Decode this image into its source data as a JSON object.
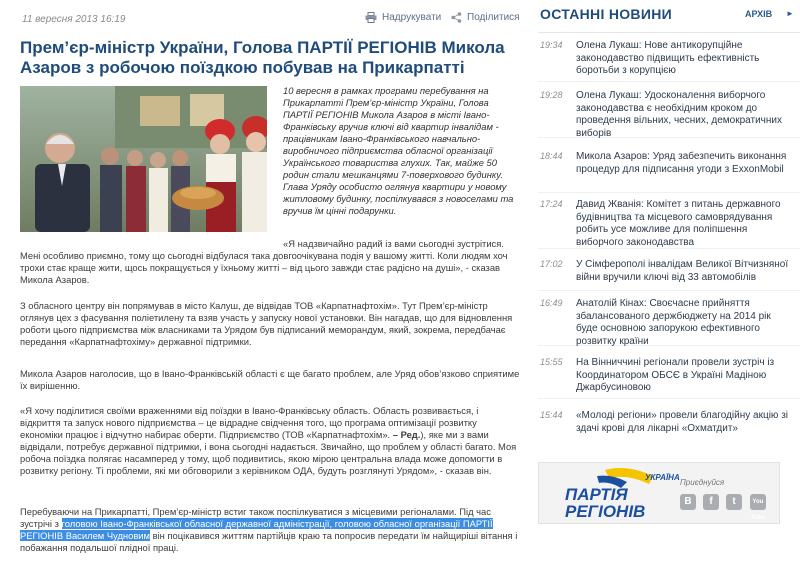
{
  "article": {
    "date": "11 вересня 2013 16:19",
    "print_label": "Надрукувати",
    "share_label": "Поділитися",
    "title": "Прем’єр-міністр України, Голова ПАРТІЇ РЕГІОНІВ Микола Азаров з робочою поїздкою побував на Прикарпатті",
    "lead": "10 вересня в рамках програми перебування на Прикарпатті Прем’єр-міністр України, Голова ПАРТІЇ РЕГІОНІВ Микола Азаров в місті Івано-Франківську вручив ключі від квартир інвалідам - працівникам Івано-Франківського навчально-виробничого підприємства обласної організації Українського товариства глухих. Так, майже 50 родин стали мешканцями 7-поверхового будинку. Глава Уряду особисто оглянув квартири у новому житловому будинку, поспілкувався з новоселами та вручив їм цінні подарунки.",
    "quote1_start": "«Я надзвичайно радий із вами сьогодні зустрітися.",
    "quote1_rest": "Мені особливо приємно, тому що сьогодні відбулася така довгоочікувана подія у вашому житті. Коли людям хоч трохи стає краще жити, щось покращується у їхньому житті – від цього завжди стає радісно на душі», - сказав Микола Азаров.",
    "p2": "З обласного центру він попрямував в місто Калуш, де відвідав ТОВ «Карпатнафтохім». Тут Прем’єр-міністр оглянув цех з фасування поліетилену та взяв участь у запуску нової установки. Він нагадав, що для відновлення роботи цього підприємства між власниками та Урядом був підписаний меморандум, який, зокрема, передбачає передання «Карпатнафтохіму» державної підтримки.",
    "p3": "Микола Азаров наголосив, що в Івано-Франківській області є ще багато проблем, але Уряд обов’язково сприятиме їх вирішенню.",
    "p4_a": "«Я хочу поділитися своїми враженнями від поїздки в Івано-Франківську область. Область розвивається, і відкриття та запуск нового підприємства – це відрадне свідчення того, що програма оптимізації розвитку економіки працює і відчутно набирає оберти. Підприємство (ТОВ «Карпатнафтохім».",
    "p4_red": "– Ред.",
    "p4_b": "), яке ми з вами відвідали, потребує державної підтримки, і вона сьогодні надається. Звичайно, що проблем у області багато. Моя робоча поїздка полягає насамперед у тому, щоб подивитись, якою мірою центральна влада може допомогти в розвитку регіону. Ті проблеми, які ми обговорили з керівником ОДА, будуть розглянуті Урядом», - сказав він.",
    "p5_a": "Перебуваючи на Прикарпатті, Прем’єр-міністр встиг також поспілкуватися з місцевими регіоналами. Під час зустрічі з",
    "p5_hl": "головою Івано-Франківської обласної державної адміністрації, головою обласної організації ПАРТІЇ РЕГІОНІВ Василем Чудновим",
    "p5_b": "він поцікавився життям партійців краю та попросив передати їм найщиріші вітання і побажання подальшої плідної праці."
  },
  "sidebar": {
    "title": "ОСТАННІ НОВИНИ",
    "archive_label": "АРХІВ",
    "news": [
      {
        "time": "19:34",
        "text": "Олена Лукаш: Нове антикорупційне законодавство підвищить ефективність боротьби з корупцією"
      },
      {
        "time": "19:28",
        "text": "Олена Лукаш: Удосконалення виборчого законодавства є необхідним кроком до проведення вільних, чесних, демократичних виборів"
      },
      {
        "time": "18:44",
        "text": "Микола Азаров: Уряд забезпечить виконання процедур для підписання угоди з ExxonMobil"
      },
      {
        "time": "17:24",
        "text": "Давид Жванія: Комітет з питань державного будівництва та місцевого самоврядування робить усе можливе для поліпшення виборчого законодавства"
      },
      {
        "time": "17:02",
        "text": "У Сімферополі інвалідам Великої Вітчизняної війни вручили ключі від 33 автомобілів"
      },
      {
        "time": "16:49",
        "text": "Анатолій Кінах: Своєчасне прийняття збалансованого держбюджету на 2014 рік буде основною запорукою ефективного розвитку країни"
      },
      {
        "time": "15:55",
        "text": "На Вінниччині регіонали провели зустріч із Координатором ОБСЄ в Україні Мадіною Джарбусиновою"
      },
      {
        "time": "15:44",
        "text": "«Молоді регіони» провели благодійну акцію зі здачі крові для лікарні «Охматдит»"
      }
    ]
  },
  "banner": {
    "logo_line1": "ПАРТІЯ",
    "logo_line2": "РЕГІОНІВ",
    "logo_ukraine": "УКРАЇНА",
    "join_label": "Приєднуйся",
    "social": [
      "В",
      "f",
      "t",
      "You Tube"
    ]
  },
  "colors": {
    "title_blue": "#1f4c7a",
    "highlight": "#3d8ee2",
    "party_blue": "#1d4fa0",
    "party_yellow": "#f5c400"
  }
}
